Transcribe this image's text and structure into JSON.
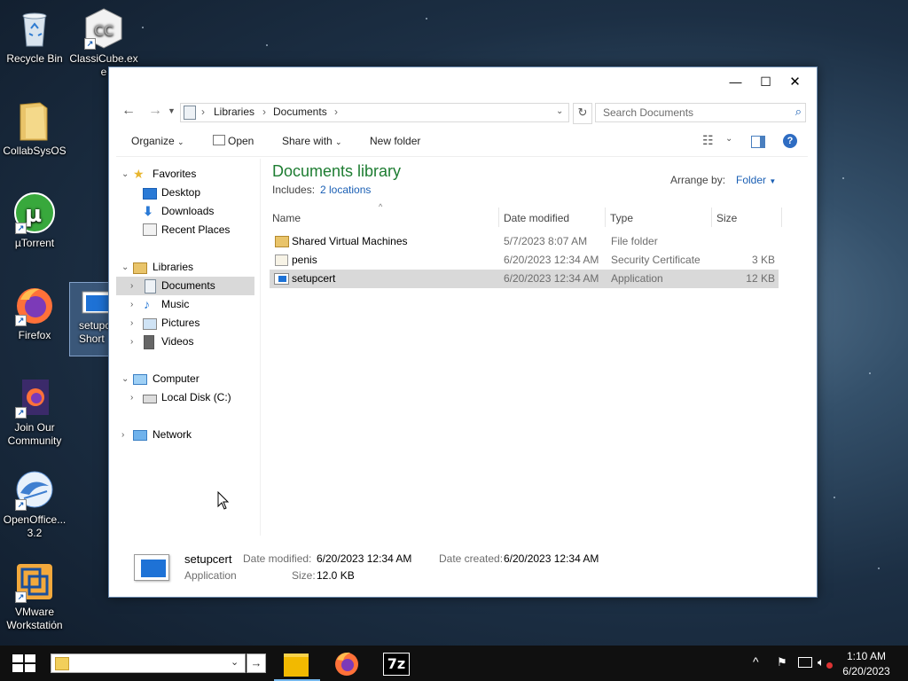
{
  "desktop": {
    "icons": [
      {
        "label": "Recycle Bin",
        "icon": "recycle-bin-icon"
      },
      {
        "label": "ClassiCube.exe",
        "icon": "classicube-icon"
      },
      {
        "label": "CollabSysOS",
        "icon": "folder-icon"
      },
      {
        "label": "µTorrent",
        "icon": "utorrent-icon"
      },
      {
        "label": "Firefox",
        "icon": "firefox-icon"
      },
      {
        "label": "setupc Short",
        "icon": "setupcert-shortcut-icon"
      },
      {
        "label": "Join Our Community",
        "icon": "join-community-icon"
      },
      {
        "label": "OpenOffice... 3.2",
        "icon": "openoffice-icon"
      },
      {
        "label": "VMware Workstation",
        "icon": "vmware-icon"
      }
    ]
  },
  "window": {
    "controls": {
      "minimize": "—",
      "maximize": "☐",
      "close": "✕"
    },
    "address": {
      "root": "Libraries",
      "current": "Documents"
    },
    "search_placeholder": "Search Documents",
    "toolbar": {
      "organize": "Organize",
      "open": "Open",
      "share": "Share with",
      "new_folder": "New folder"
    },
    "nav": {
      "favorites": "Favorites",
      "desktop": "Desktop",
      "downloads": "Downloads",
      "recent": "Recent Places",
      "libraries": "Libraries",
      "documents": "Documents",
      "music": "Music",
      "pictures": "Pictures",
      "videos": "Videos",
      "computer": "Computer",
      "local_disk": "Local Disk (C:)",
      "network": "Network"
    },
    "library": {
      "title": "Documents library",
      "includes_label": "Includes:",
      "includes_value": "2 locations",
      "arrange_label": "Arrange by:",
      "arrange_value": "Folder"
    },
    "columns": {
      "name": "Name",
      "date": "Date modified",
      "type": "Type",
      "size": "Size"
    },
    "files": [
      {
        "name": "Shared Virtual Machines",
        "date": "5/7/2023 8:07 AM",
        "type": "File folder",
        "size": ""
      },
      {
        "name": "penis",
        "date": "6/20/2023 12:34 AM",
        "type": "Security Certificate",
        "size": "3 KB"
      },
      {
        "name": "setupcert",
        "date": "6/20/2023 12:34 AM",
        "type": "Application",
        "size": "12 KB"
      }
    ],
    "details": {
      "name": "setupcert",
      "kind": "Application",
      "modified_label": "Date modified:",
      "modified_value": "6/20/2023 12:34 AM",
      "created_label": "Date created:",
      "created_value": "6/20/2023 12:34 AM",
      "size_label": "Size:",
      "size_value": "12.0 KB"
    }
  },
  "taskbar": {
    "clock_time": "1:10 AM",
    "clock_date": "6/20/2023"
  }
}
